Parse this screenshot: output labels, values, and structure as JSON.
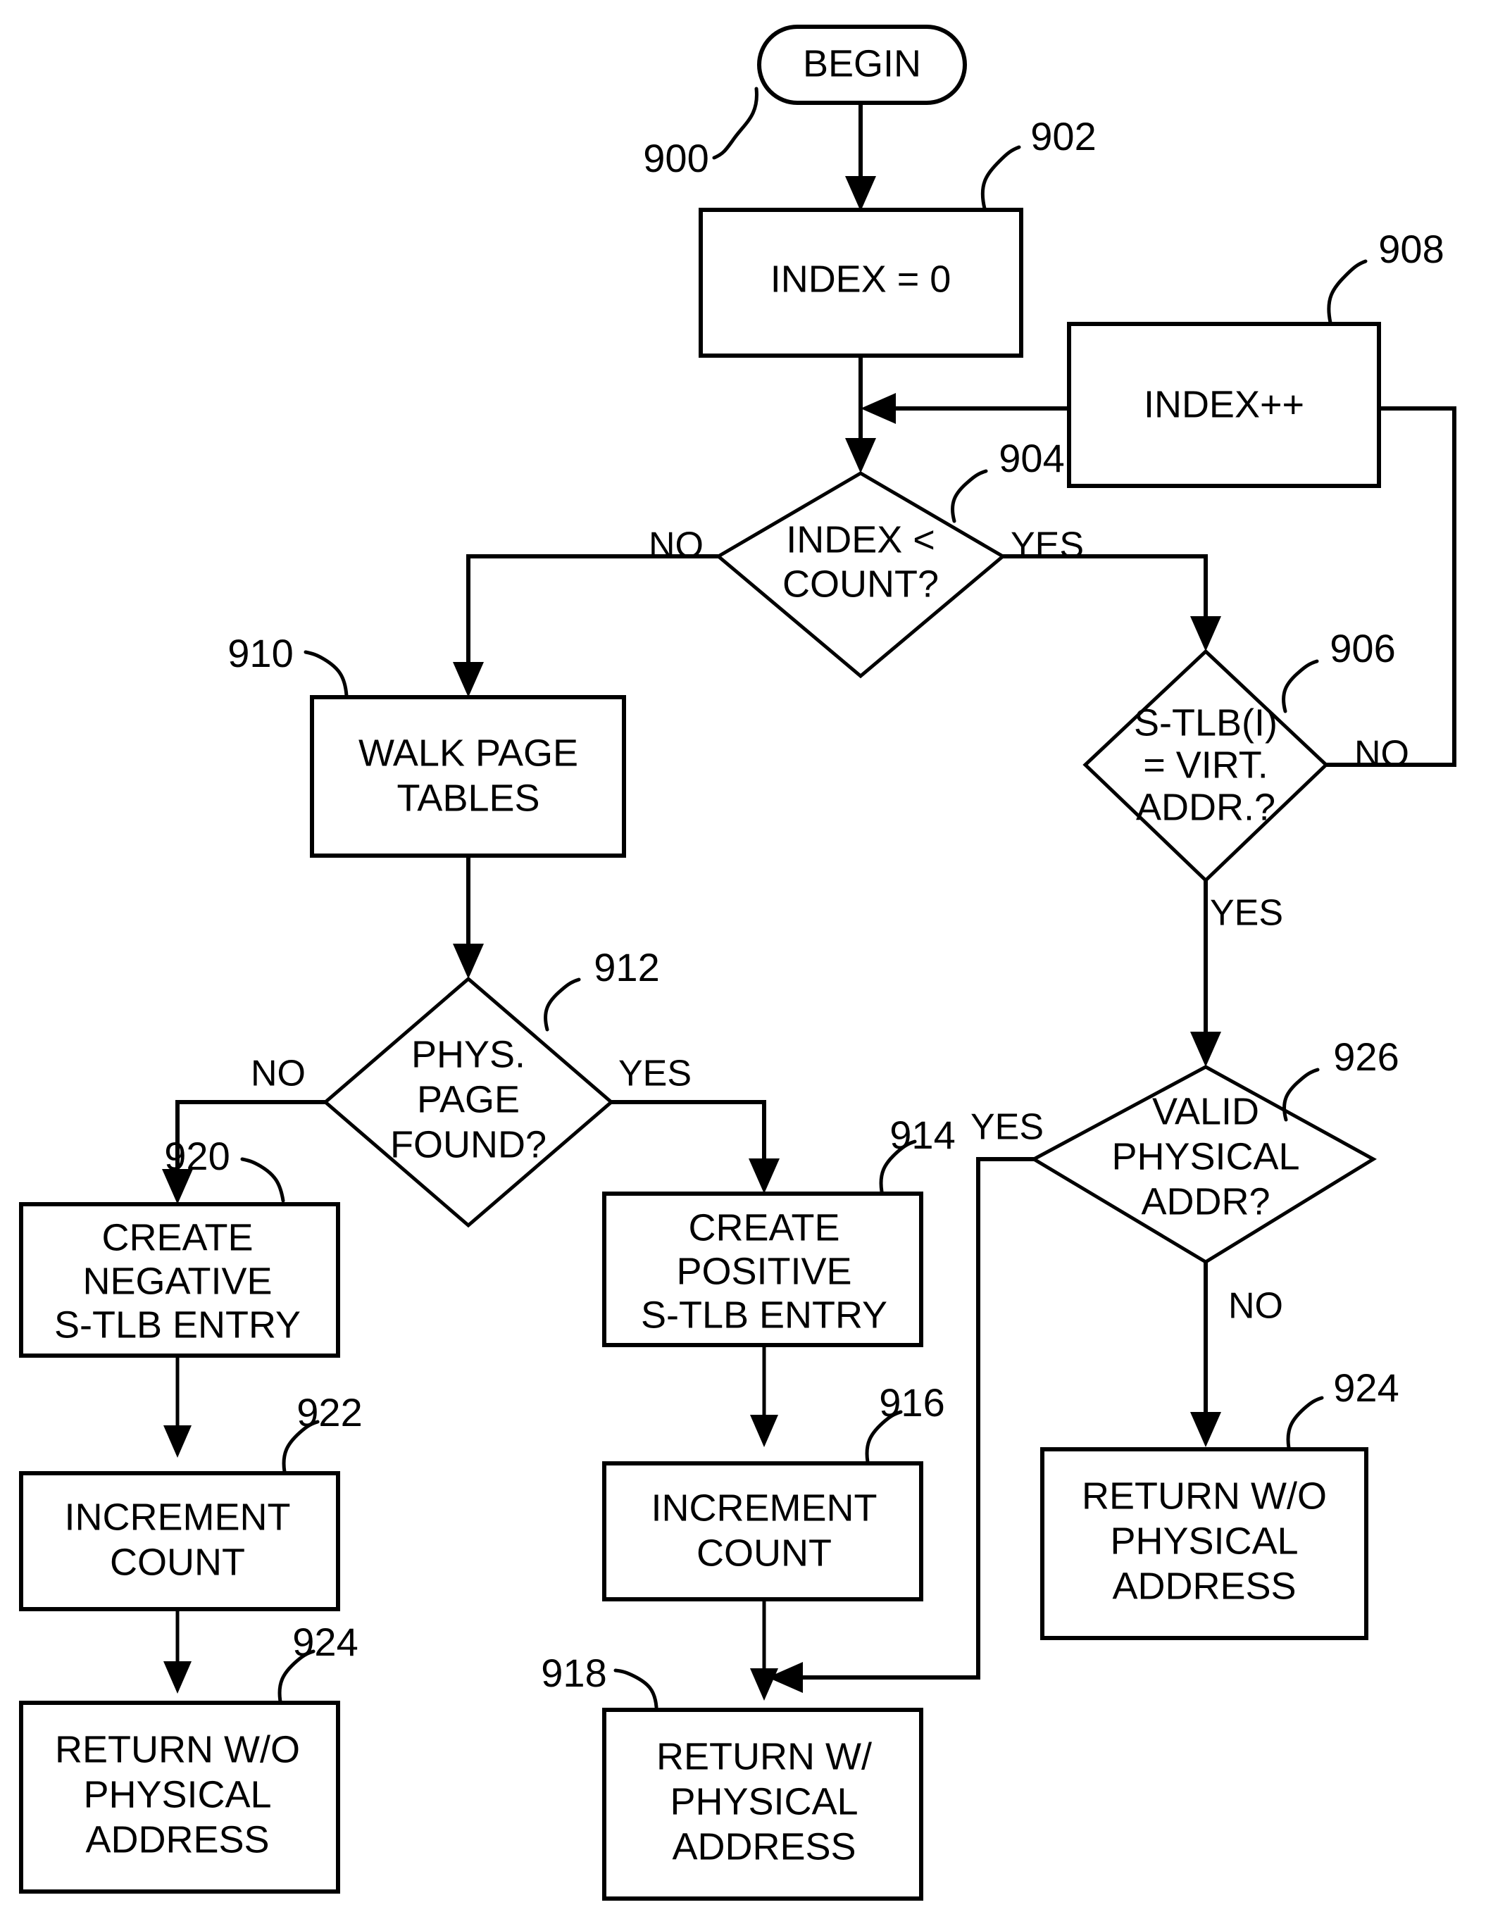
{
  "diagram": {
    "title": "S-TLB lookup flowchart",
    "stroke_color": "#000000",
    "background_color": "#ffffff",
    "nodes": [
      {
        "id": "begin",
        "ref": "900",
        "shape": "terminator",
        "lines": [
          "BEGIN"
        ]
      },
      {
        "id": "index_zero",
        "ref": "902",
        "shape": "process",
        "lines": [
          "INDEX = 0"
        ]
      },
      {
        "id": "index_inc",
        "ref": "908",
        "shape": "process",
        "lines": [
          "INDEX++"
        ]
      },
      {
        "id": "index_count",
        "ref": "904",
        "shape": "decision",
        "lines": [
          "INDEX <",
          "COUNT?"
        ]
      },
      {
        "id": "stlb_match",
        "ref": "906",
        "shape": "decision",
        "lines": [
          "S-TLB(I)",
          "= VIRT.",
          "ADDR.?"
        ]
      },
      {
        "id": "walk_pages",
        "ref": "910",
        "shape": "process",
        "lines": [
          "WALK PAGE",
          "TABLES"
        ]
      },
      {
        "id": "phys_found",
        "ref": "912",
        "shape": "decision",
        "lines": [
          "PHYS.",
          "PAGE",
          "FOUND?"
        ]
      },
      {
        "id": "valid_phys",
        "ref": "926",
        "shape": "decision",
        "lines": [
          "VALID",
          "PHYSICAL",
          "ADDR?"
        ]
      },
      {
        "id": "create_neg",
        "ref": "920",
        "shape": "process",
        "lines": [
          "CREATE",
          "NEGATIVE",
          "S-TLB ENTRY"
        ]
      },
      {
        "id": "create_pos",
        "ref": "914",
        "shape": "process",
        "lines": [
          "CREATE",
          "POSITIVE",
          "S-TLB ENTRY"
        ]
      },
      {
        "id": "inc_count_l",
        "ref": "922",
        "shape": "process",
        "lines": [
          "INCREMENT",
          "COUNT"
        ]
      },
      {
        "id": "inc_count_m",
        "ref": "916",
        "shape": "process",
        "lines": [
          "INCREMENT",
          "COUNT"
        ]
      },
      {
        "id": "ret_wo_left",
        "ref": "924",
        "shape": "process",
        "lines": [
          "RETURN W/O",
          "PHYSICAL",
          "ADDRESS"
        ]
      },
      {
        "id": "ret_w_mid",
        "ref": "918",
        "shape": "process",
        "lines": [
          "RETURN W/",
          "PHYSICAL",
          "ADDRESS"
        ]
      },
      {
        "id": "ret_wo_right",
        "ref": "924",
        "shape": "process",
        "lines": [
          "RETURN W/O",
          "PHYSICAL",
          "ADDRESS"
        ]
      }
    ],
    "branch_labels": {
      "index_count_no": "NO",
      "index_count_yes": "YES",
      "stlb_match_no": "NO",
      "stlb_match_yes": "YES",
      "phys_found_no": "NO",
      "phys_found_yes": "YES",
      "valid_phys_yes": "YES",
      "valid_phys_no": "NO"
    },
    "reference_numerals": [
      "900",
      "902",
      "904",
      "906",
      "908",
      "910",
      "912",
      "914",
      "916",
      "918",
      "920",
      "922",
      "924",
      "926"
    ]
  }
}
